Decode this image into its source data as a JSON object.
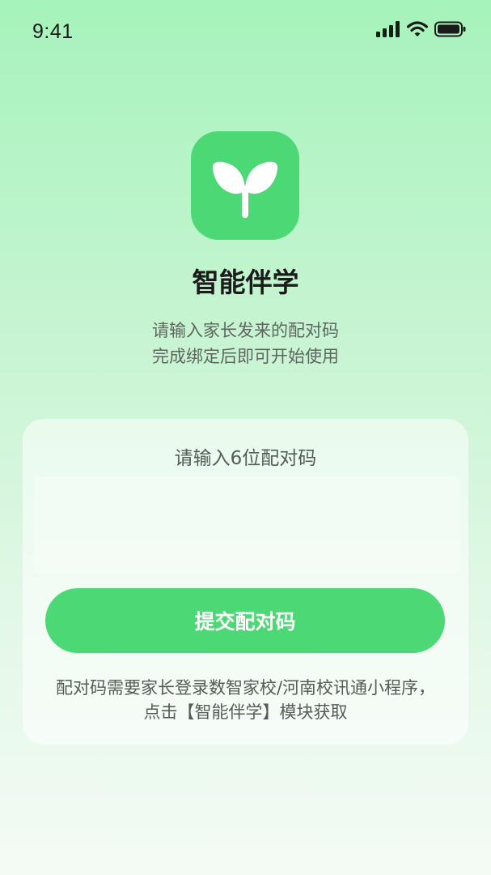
{
  "status_bar": {
    "time": "9:41",
    "icons": [
      "signal-icon",
      "wifi-icon",
      "battery-icon"
    ]
  },
  "app": {
    "icon": "sprout-icon",
    "name": "智能伴学",
    "subtitle_line1": "请输入家长发来的配对码",
    "subtitle_line2": "完成绑定后即可开始使用"
  },
  "pairing": {
    "input_label": "请输入6位配对码",
    "code_value": "",
    "submit_label": "提交配对码",
    "hint": "配对码需要家长登录数智家校/河南校讯通小程序，点击【智能伴学】模块获取"
  },
  "colors": {
    "accent": "#4cd875",
    "background_top": "#a6f3bb",
    "background_bottom": "#f4fbf5"
  }
}
